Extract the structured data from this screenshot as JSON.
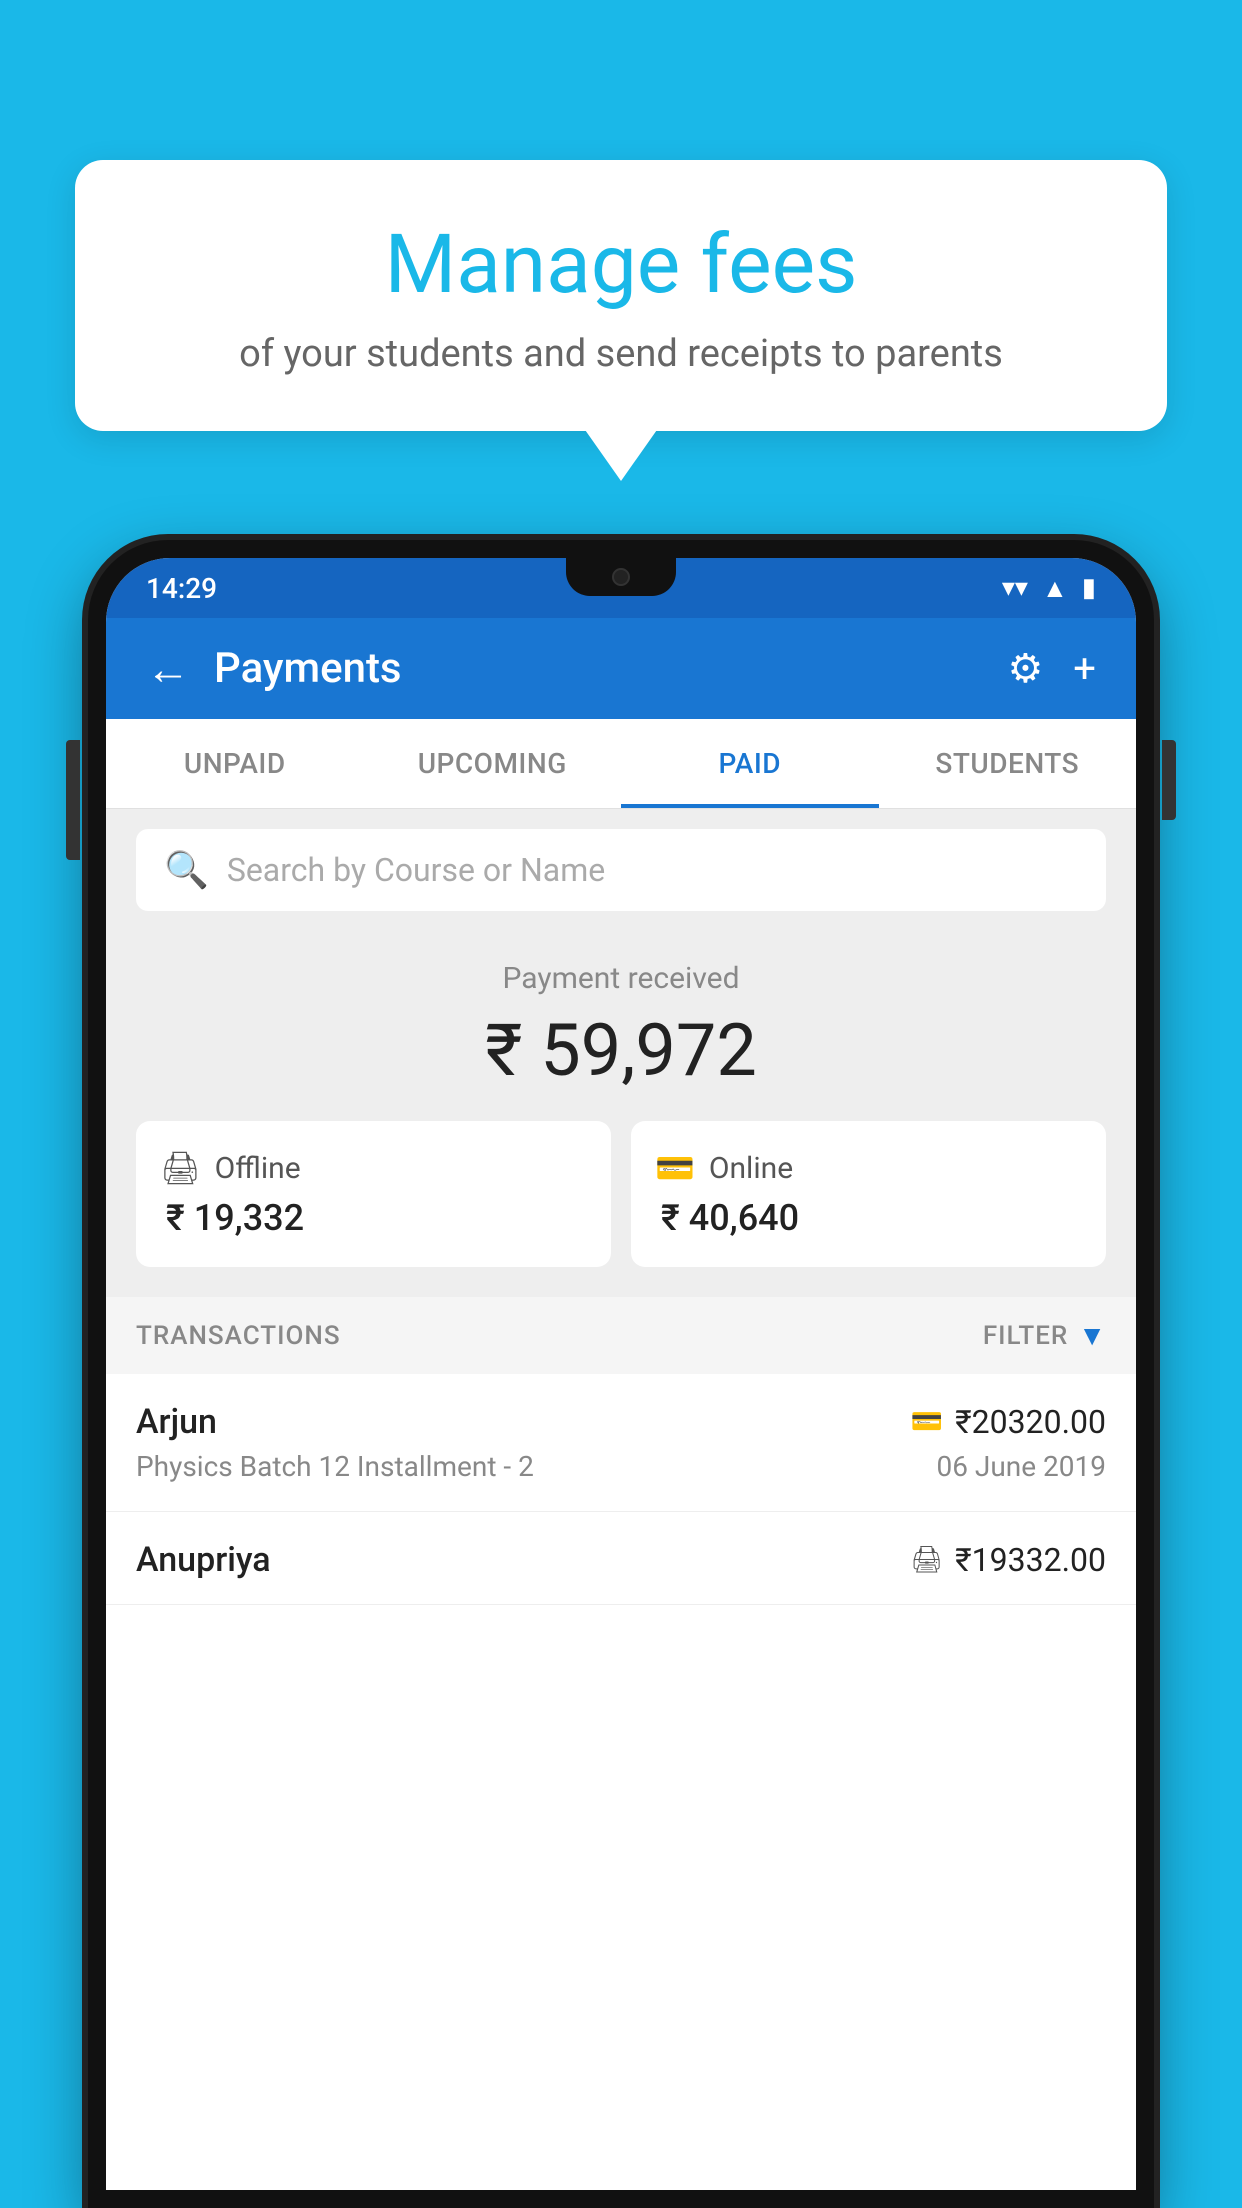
{
  "bubble": {
    "title": "Manage fees",
    "subtitle": "of your students and send receipts to parents"
  },
  "status_bar": {
    "time": "14:29",
    "wifi_icon": "▾",
    "signal_icon": "▲",
    "battery_icon": "▮"
  },
  "header": {
    "title": "Payments",
    "back_icon": "←",
    "gear_icon": "⚙",
    "plus_icon": "+"
  },
  "tabs": [
    {
      "label": "UNPAID",
      "active": false
    },
    {
      "label": "UPCOMING",
      "active": false
    },
    {
      "label": "PAID",
      "active": true
    },
    {
      "label": "STUDENTS",
      "active": false
    }
  ],
  "search": {
    "placeholder": "Search by Course or Name"
  },
  "payment": {
    "label": "Payment received",
    "total": "₹ 59,972",
    "offline_label": "Offline",
    "offline_amount": "₹ 19,332",
    "online_label": "Online",
    "online_amount": "₹ 40,640"
  },
  "transactions": {
    "header_label": "TRANSACTIONS",
    "filter_label": "FILTER",
    "items": [
      {
        "name": "Arjun",
        "amount": "₹20320.00",
        "course": "Physics Batch 12 Installment - 2",
        "date": "06 June 2019",
        "icon_type": "online"
      },
      {
        "name": "Anupriya",
        "amount": "₹19332.00",
        "course": "",
        "date": "",
        "icon_type": "offline"
      }
    ]
  },
  "colors": {
    "sky_blue": "#1ab8e8",
    "primary_blue": "#1976d2",
    "dark_blue": "#1565c0"
  }
}
